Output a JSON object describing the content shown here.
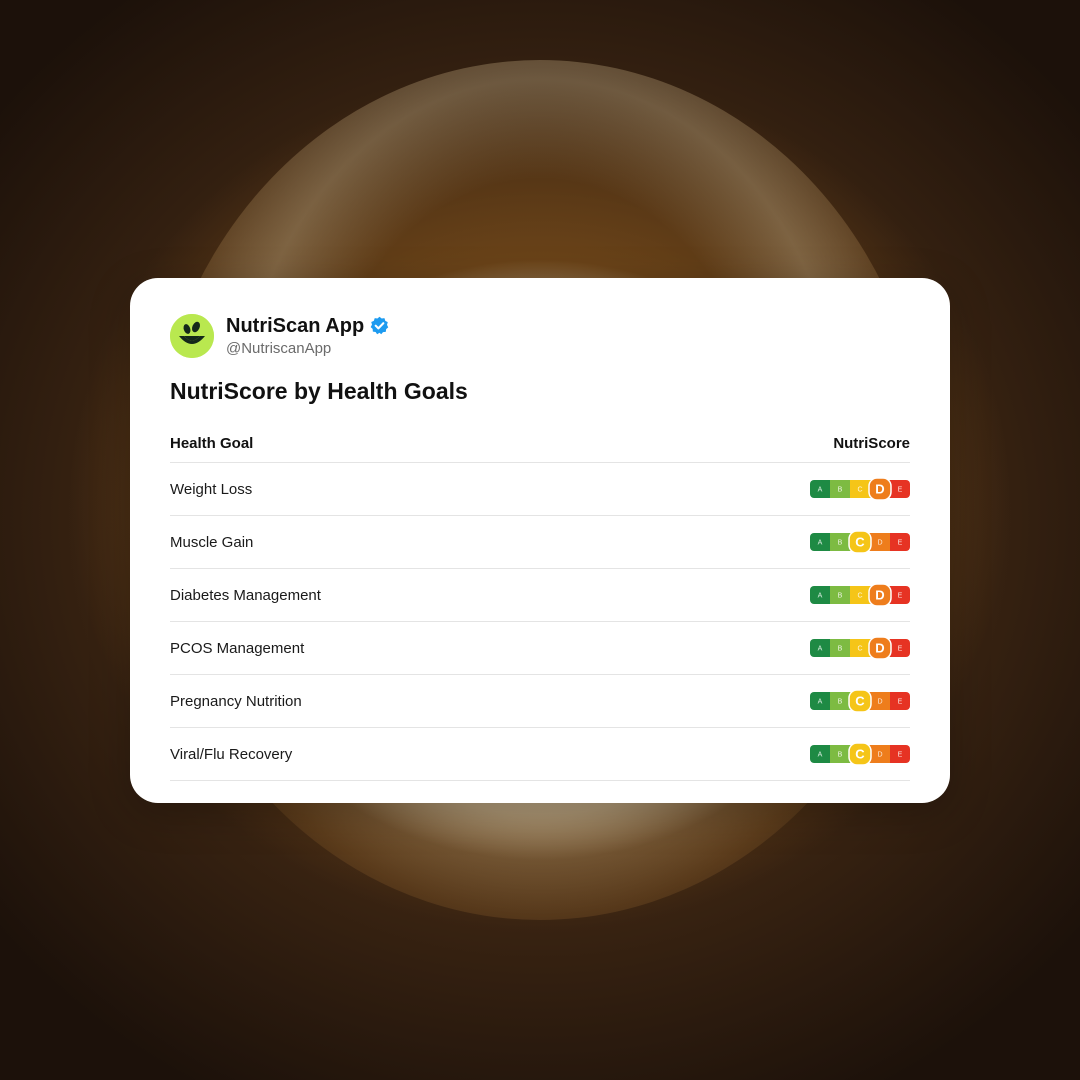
{
  "account": {
    "name": "NutriScan App",
    "handle": "@NutriscanApp",
    "verified_icon": "verified-badge-icon",
    "avatar_icon": "nutriscan-logo-icon"
  },
  "title": "NutriScore by Health Goals",
  "table": {
    "headers": [
      "Health Goal",
      "NutriScore"
    ],
    "rows": [
      {
        "goal": "Weight Loss",
        "score": "D"
      },
      {
        "goal": "Muscle Gain",
        "score": "C"
      },
      {
        "goal": "Diabetes Management",
        "score": "D"
      },
      {
        "goal": "PCOS Management",
        "score": "D"
      },
      {
        "goal": "Pregnancy Nutrition",
        "score": "C"
      },
      {
        "goal": "Viral/Flu Recovery",
        "score": "C"
      }
    ]
  },
  "nutriscore_scale": {
    "letters": [
      "A",
      "B",
      "C",
      "D",
      "E"
    ],
    "colors": [
      "#1e8a44",
      "#7dbb42",
      "#f5c518",
      "#ee7d1c",
      "#e63323"
    ]
  },
  "colors": {
    "avatar_bg": "#b9e84f",
    "verified": "#1d9bf0"
  }
}
